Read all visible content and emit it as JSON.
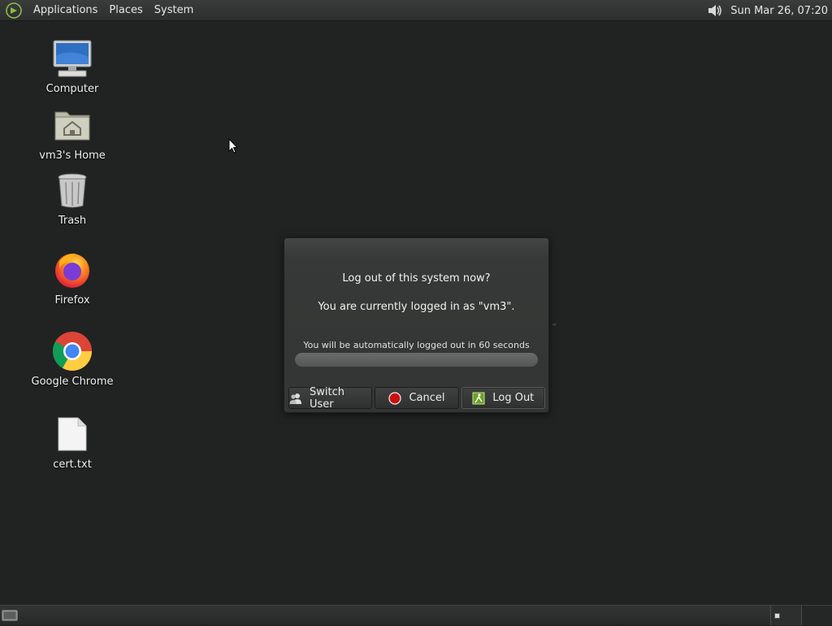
{
  "top_panel": {
    "menus": [
      "Applications",
      "Places",
      "System"
    ],
    "clock": "Sun Mar 26, 07:20",
    "icons": {
      "menu_logo": "mate-logo-icon",
      "volume": "volume-icon"
    }
  },
  "desktop": {
    "icons": [
      {
        "label": "Computer",
        "icon": "computer-icon"
      },
      {
        "label": "vm3's Home",
        "icon": "home-folder-icon"
      },
      {
        "label": "Trash",
        "icon": "trash-icon"
      },
      {
        "label": "Firefox",
        "icon": "firefox-icon"
      },
      {
        "label": "Google Chrome",
        "icon": "chrome-icon"
      },
      {
        "label": "cert.txt",
        "icon": "text-file-icon"
      }
    ]
  },
  "dialog": {
    "title": "Log out of this system now?",
    "subtitle": "You are currently logged in as \"vm3\".",
    "countdown": "You will be automatically logged out in 60 seconds",
    "progress_fraction": 1.0,
    "buttons": {
      "switch_user": "Switch User",
      "cancel": "Cancel",
      "log_out": "Log Out"
    }
  },
  "bottom_panel": {
    "icons": {
      "show_desktop": "show-desktop-icon"
    },
    "workspaces": 2
  },
  "colors": {
    "desktop_bg": "#212322",
    "dialog_bg": "#373938",
    "cancel_red": "#cc1010",
    "logout_green": "#6aa02a"
  }
}
